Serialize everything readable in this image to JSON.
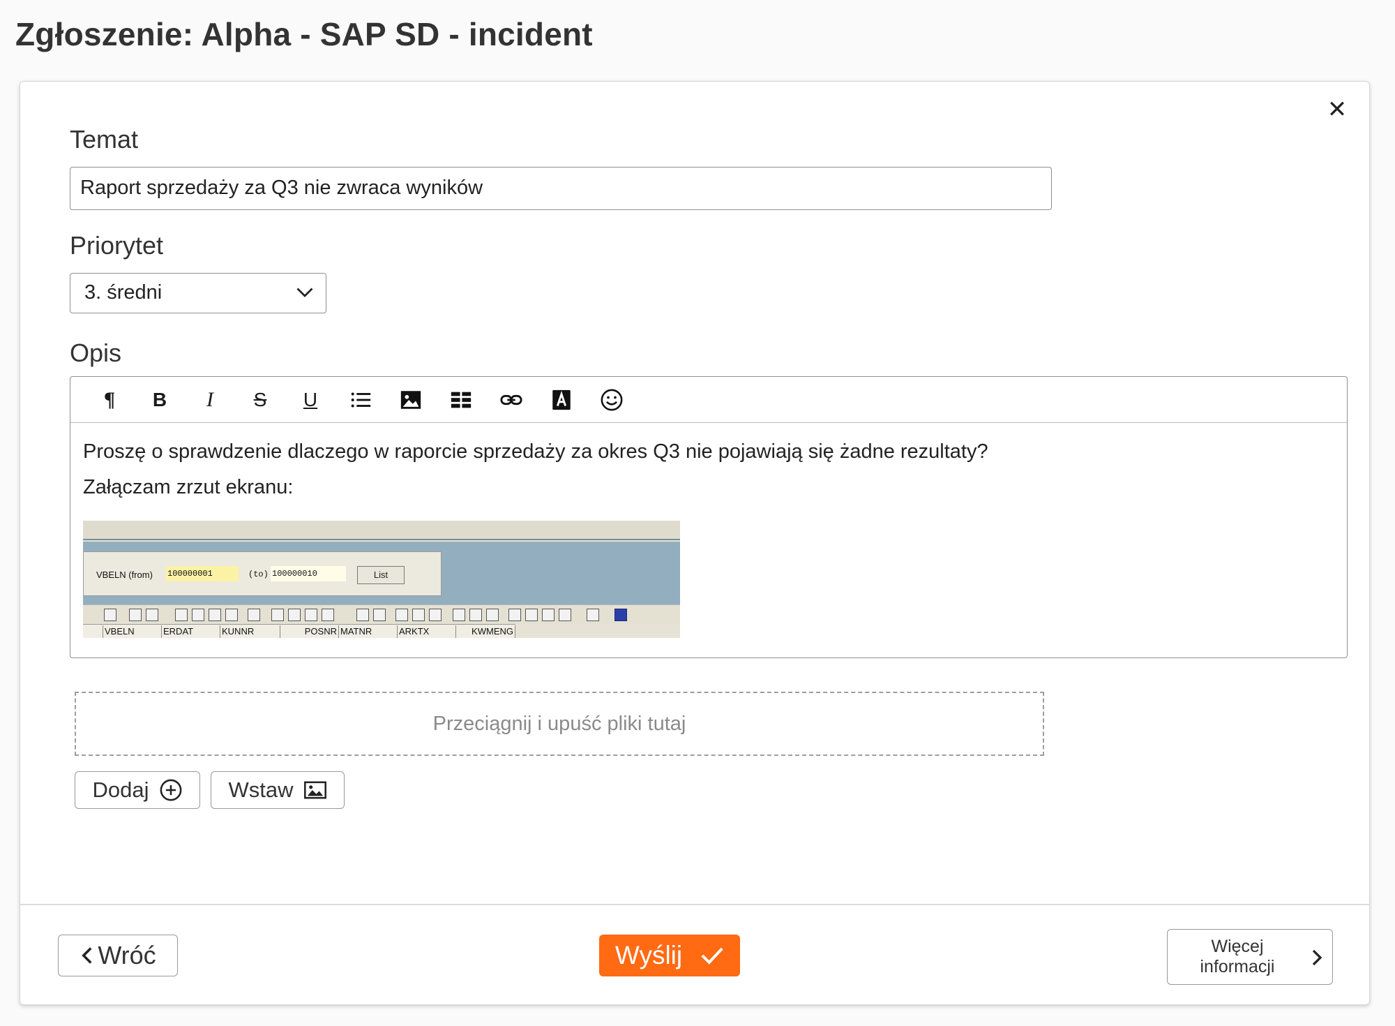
{
  "page": {
    "title": "Zgłoszenie: Alpha - SAP SD - incident"
  },
  "form": {
    "subject_label": "Temat",
    "subject_value": "Raport sprzedaży za Q3 nie zwraca wyników",
    "priority_label": "Priorytet",
    "priority_value": "3. średni",
    "description_label": "Opis",
    "description_lines": [
      "Proszę o sprawdzenie dlaczego w raporcie sprzedaży za okres Q3 nie pojawiają się żadne rezultaty?",
      "Załączam zrzut ekranu:"
    ],
    "dropzone_text": "Przeciągnij i upuść pliki tutaj",
    "add_button": "Dodaj",
    "insert_button": "Wstaw"
  },
  "editor_toolbar": {
    "tools": [
      "paragraph-icon",
      "bold-icon",
      "italic-icon",
      "strikethrough-icon",
      "underline-icon",
      "list-icon",
      "image-icon",
      "table-icon",
      "link-icon",
      "text-color-icon",
      "emoji-icon"
    ]
  },
  "sap_screenshot": {
    "from_label": "VBELN (from)",
    "from_value": "100000001",
    "to_label": "(to)",
    "to_value": "100000010",
    "list_button": "List",
    "columns": [
      "VBELN",
      "ERDAT",
      "KUNNR",
      "POSNR",
      "MATNR",
      "ARKTX",
      "KWMENG"
    ]
  },
  "footer": {
    "back_button": "Wróć",
    "submit_button": "Wyślij",
    "more_info_line1": "Więcej",
    "more_info_line2": "informacji"
  },
  "colors": {
    "accent": "#ff6a13",
    "border": "#8f8f8f",
    "text": "#333333"
  }
}
